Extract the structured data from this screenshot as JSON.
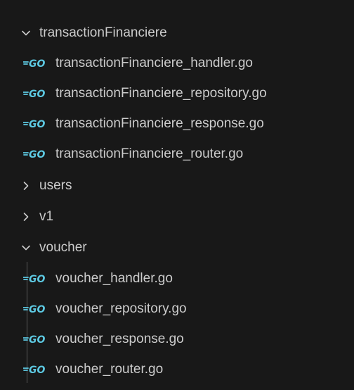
{
  "explorer": {
    "folders": [
      {
        "label": "transactionFinanciere",
        "expanded": true,
        "files": [
          "transactionFinanciere_handler.go",
          "transactionFinanciere_repository.go",
          "transactionFinanciere_response.go",
          "transactionFinanciere_router.go"
        ]
      },
      {
        "label": "users",
        "expanded": false,
        "files": []
      },
      {
        "label": "v1",
        "expanded": false,
        "files": []
      },
      {
        "label": "voucher",
        "expanded": true,
        "files": [
          "voucher_handler.go",
          "voucher_repository.go",
          "voucher_response.go",
          "voucher_router.go"
        ]
      }
    ],
    "icons": {
      "expanded": "chevron-down-icon",
      "collapsed": "chevron-right-icon",
      "file": "go-file-icon"
    },
    "colors": {
      "background": "#181818",
      "text": "#cccccc",
      "go_icon": "#5dc9e2",
      "indent_guide": "#585858"
    }
  }
}
